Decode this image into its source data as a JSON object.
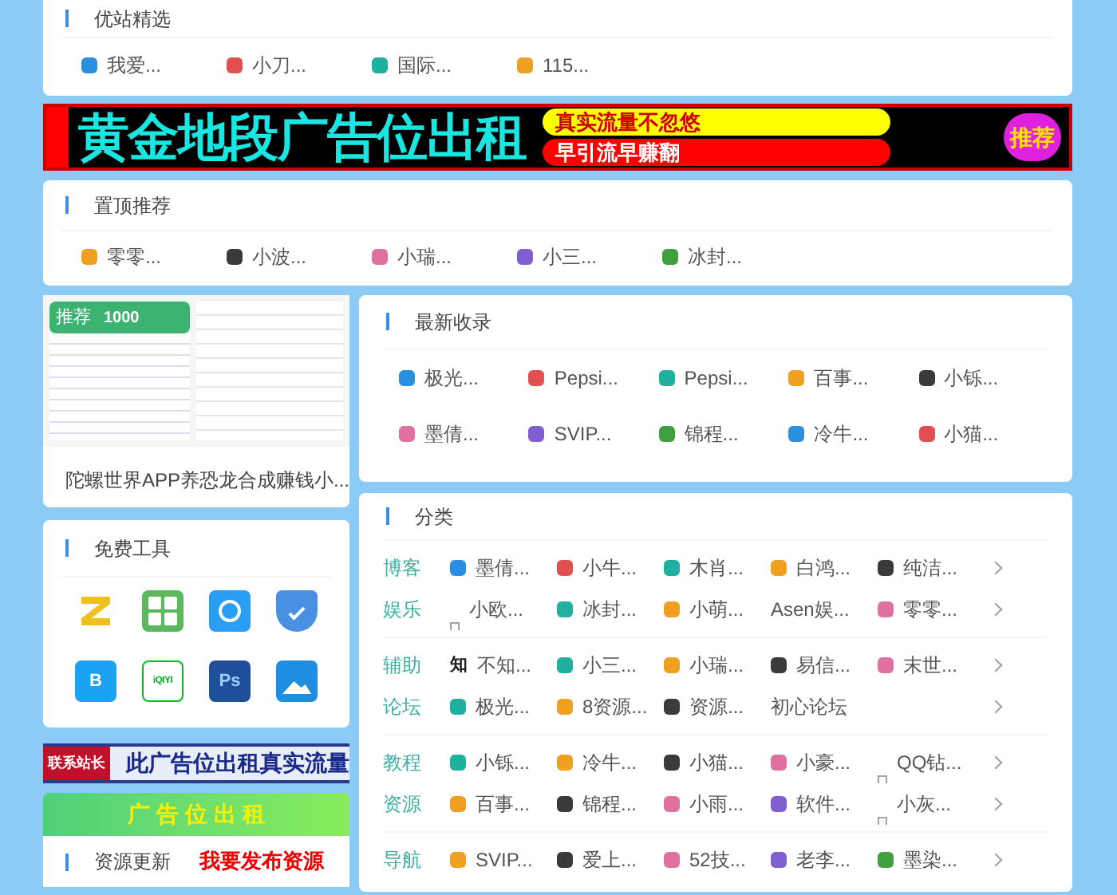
{
  "top_picks": {
    "title": "优站精选",
    "items": [
      {
        "label": "我爱...",
        "kind": "logo"
      },
      {
        "label": "小刀...",
        "kind": "logo"
      },
      {
        "label": "国际...",
        "kind": "logo"
      },
      {
        "label": "115...",
        "kind": "logo"
      }
    ]
  },
  "banner_ad": {
    "headline": "黄金地段广告位出租",
    "line_1": "真实流量不忽悠",
    "line_2": "早引流早赚翻",
    "badge": "推荐"
  },
  "pinned": {
    "title": "置顶推荐",
    "items": [
      {
        "label": "零零...",
        "kind": "logo"
      },
      {
        "label": "小波...",
        "kind": "logo"
      },
      {
        "label": "小瑞...",
        "kind": "logo"
      },
      {
        "label": "小三...",
        "kind": "logo"
      },
      {
        "label": "冰封...",
        "kind": "logo"
      }
    ]
  },
  "featured": {
    "badge": "推荐",
    "amount": "1000",
    "caption": "陀螺世界APP养恐龙合成赚钱小..."
  },
  "free_tools": {
    "title": "免费工具",
    "items": [
      {
        "kind": "z"
      },
      {
        "kind": "grid"
      },
      {
        "kind": "camera"
      },
      {
        "kind": "shield"
      },
      {
        "kind": "letter",
        "glyph": "B"
      },
      {
        "kind": "iqiyi",
        "glyph": "iQIYI"
      },
      {
        "kind": "ps",
        "glyph": "Ps"
      },
      {
        "kind": "picture"
      }
    ]
  },
  "side_ad": {
    "tag": "联系站长",
    "text": "此广告位出租真实流量"
  },
  "green_ad": {
    "text": "广 告 位 出 租"
  },
  "resources": {
    "title": "资源更新",
    "action": "我要发布资源"
  },
  "latest": {
    "title": "最新收录",
    "items": [
      {
        "label": "极光...",
        "kind": "logo"
      },
      {
        "label": "Pepsi...",
        "kind": "logo"
      },
      {
        "label": "Pepsi...",
        "kind": "logo"
      },
      {
        "label": "百事...",
        "kind": "logo"
      },
      {
        "label": "小铄...",
        "kind": "logo"
      },
      {
        "label": "墨倩...",
        "kind": "logo"
      },
      {
        "label": "SVIP...",
        "kind": "logo"
      },
      {
        "label": "锦程...",
        "kind": "logo"
      },
      {
        "label": "冷牛...",
        "kind": "logo"
      },
      {
        "label": "小猫...",
        "kind": "logo"
      }
    ]
  },
  "categories": {
    "title": "分类",
    "groups": [
      [
        {
          "name": "博客",
          "items": [
            {
              "label": "墨倩...",
              "kind": "logo"
            },
            {
              "label": "小牛...",
              "kind": "logo"
            },
            {
              "label": "木肖...",
              "kind": "logo"
            },
            {
              "label": "白鸿...",
              "kind": "logo"
            },
            {
              "label": "纯洁...",
              "kind": "logo"
            }
          ]
        },
        {
          "name": "娱乐",
          "items": [
            {
              "label": "小欧...",
              "kind": "broken"
            },
            {
              "label": "冰封...",
              "kind": "logo"
            },
            {
              "label": "小萌...",
              "kind": "logo"
            },
            {
              "label": "Asen娱...",
              "kind": "none"
            },
            {
              "label": "零零...",
              "kind": "logo"
            }
          ]
        }
      ],
      [
        {
          "name": "辅助",
          "items": [
            {
              "label": "不知...",
              "kind": "glyph",
              "glyph": "知"
            },
            {
              "label": "小三...",
              "kind": "logo"
            },
            {
              "label": "小瑞...",
              "kind": "logo"
            },
            {
              "label": "易信...",
              "kind": "logo"
            },
            {
              "label": "末世...",
              "kind": "logo"
            }
          ]
        },
        {
          "name": "论坛",
          "items": [
            {
              "label": "极光...",
              "kind": "logo"
            },
            {
              "label": "8资源...",
              "kind": "logo"
            },
            {
              "label": "资源...",
              "kind": "logo"
            },
            {
              "label": "初心论坛",
              "kind": "none"
            }
          ]
        }
      ],
      [
        {
          "name": "教程",
          "items": [
            {
              "label": "小铄...",
              "kind": "logo"
            },
            {
              "label": "冷牛...",
              "kind": "logo"
            },
            {
              "label": "小猫...",
              "kind": "logo"
            },
            {
              "label": "小豪...",
              "kind": "logo"
            },
            {
              "label": "QQ钻...",
              "kind": "broken"
            }
          ]
        },
        {
          "name": "资源",
          "items": [
            {
              "label": "百事...",
              "kind": "logo"
            },
            {
              "label": "锦程...",
              "kind": "logo"
            },
            {
              "label": "小雨...",
              "kind": "logo"
            },
            {
              "label": "软件...",
              "kind": "logo"
            },
            {
              "label": "小灰...",
              "kind": "broken"
            }
          ]
        }
      ],
      [
        {
          "name": "导航",
          "items": [
            {
              "label": "SVIP...",
              "kind": "logo"
            },
            {
              "label": "爱上...",
              "kind": "logo"
            },
            {
              "label": "52技...",
              "kind": "logo"
            },
            {
              "label": "老李...",
              "kind": "logo"
            },
            {
              "label": "墨染...",
              "kind": "logo"
            }
          ]
        }
      ]
    ]
  }
}
